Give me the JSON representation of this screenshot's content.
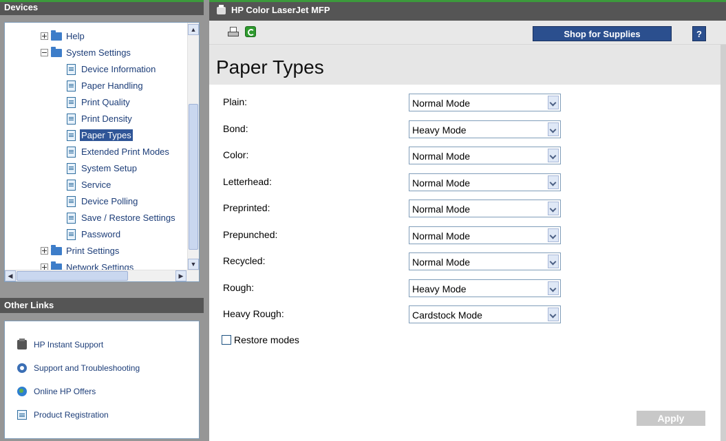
{
  "left": {
    "devices_title": "Devices",
    "tree": [
      {
        "label": "Help",
        "type": "folder",
        "expander": "plus",
        "selected": false
      },
      {
        "label": "System Settings",
        "type": "folder",
        "expander": "minus",
        "selected": false
      },
      {
        "label": "Device Information",
        "type": "page",
        "selected": false
      },
      {
        "label": "Paper Handling",
        "type": "page",
        "selected": false
      },
      {
        "label": "Print Quality",
        "type": "page",
        "selected": false
      },
      {
        "label": "Print Density",
        "type": "page",
        "selected": false
      },
      {
        "label": "Paper Types",
        "type": "page",
        "selected": true
      },
      {
        "label": "Extended Print Modes",
        "type": "page",
        "selected": false
      },
      {
        "label": "System Setup",
        "type": "page",
        "selected": false
      },
      {
        "label": "Service",
        "type": "page",
        "selected": false
      },
      {
        "label": "Device Polling",
        "type": "page",
        "selected": false
      },
      {
        "label": "Save / Restore Settings",
        "type": "page",
        "selected": false
      },
      {
        "label": "Password",
        "type": "page",
        "selected": false
      },
      {
        "label": "Print Settings",
        "type": "folder",
        "expander": "plus",
        "selected": false
      },
      {
        "label": "Network Settings",
        "type": "folder",
        "expander": "plus",
        "selected": false
      }
    ],
    "other_links_title": "Other Links",
    "other_links": [
      {
        "label": "HP Instant Support",
        "icon": "printer-icon"
      },
      {
        "label": "Support and Troubleshooting",
        "icon": "lifebuoy-icon"
      },
      {
        "label": "Online HP Offers",
        "icon": "globe-icon"
      },
      {
        "label": "Product Registration",
        "icon": "document-icon"
      }
    ]
  },
  "window": {
    "title": "HP Color LaserJet MFP"
  },
  "toolbar": {
    "shop_label": "Shop for Supplies",
    "help_label": "?"
  },
  "page": {
    "title": "Paper Types",
    "rows": [
      {
        "label": "Plain:",
        "value": "Normal Mode"
      },
      {
        "label": "Bond:",
        "value": "Heavy Mode"
      },
      {
        "label": "Color:",
        "value": "Normal Mode"
      },
      {
        "label": "Letterhead:",
        "value": "Normal Mode"
      },
      {
        "label": "Preprinted:",
        "value": "Normal Mode"
      },
      {
        "label": "Prepunched:",
        "value": "Normal Mode"
      },
      {
        "label": "Recycled:",
        "value": "Normal Mode"
      },
      {
        "label": "Rough:",
        "value": "Heavy Mode"
      },
      {
        "label": "Heavy Rough:",
        "value": "Cardstock Mode"
      }
    ],
    "restore_label": "Restore modes",
    "apply_label": "Apply"
  }
}
